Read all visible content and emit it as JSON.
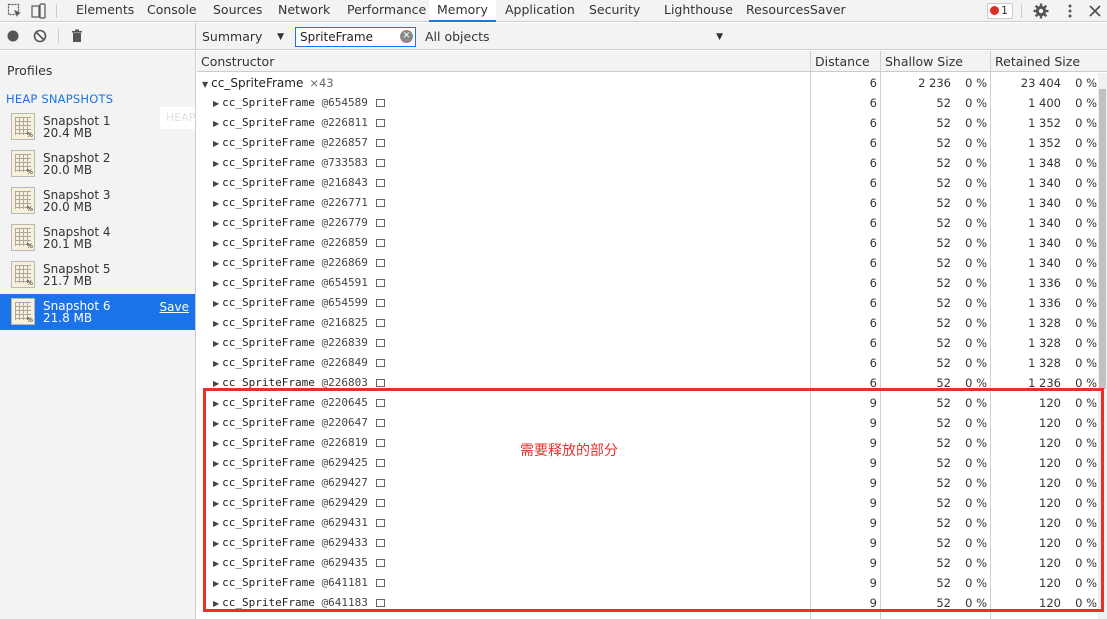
{
  "tabs": {
    "items": [
      "Elements",
      "Console",
      "Sources",
      "Network",
      "Performance",
      "Memory",
      "Application",
      "Security",
      "Lighthouse",
      "ResourcesSaver"
    ],
    "active": "Memory",
    "error_count": "1"
  },
  "toolbar": {
    "view": "Summary",
    "filter_value": "SpriteFrame",
    "objects": "All objects"
  },
  "sidebar": {
    "title": "Profiles",
    "section": "HEAP SNAPSHOTS",
    "ghost_text": "HEAP S",
    "snapshots": [
      {
        "name": "Snapshot 1",
        "size": "20.4 MB"
      },
      {
        "name": "Snapshot 2",
        "size": "20.0 MB"
      },
      {
        "name": "Snapshot 3",
        "size": "20.0 MB"
      },
      {
        "name": "Snapshot 4",
        "size": "20.1 MB"
      },
      {
        "name": "Snapshot 5",
        "size": "21.7 MB"
      },
      {
        "name": "Snapshot 6",
        "size": "21.8 MB"
      }
    ],
    "selected_index": 5,
    "save_label": "Save"
  },
  "table": {
    "headers": {
      "constructor": "Constructor",
      "distance": "Distance",
      "shallow": "Shallow Size",
      "retained": "Retained Size"
    },
    "group": {
      "name": "cc_SpriteFrame",
      "count": "×43",
      "distance": "6",
      "shallow": "2 236",
      "shallow_pct": "0 %",
      "retained": "23 404",
      "retained_pct": "0 %"
    },
    "rows": [
      {
        "name": "cc_SpriteFrame",
        "id": "@654589",
        "distance": "6",
        "shallow": "52",
        "shallow_pct": "0 %",
        "retained": "1 400",
        "retained_pct": "0 %"
      },
      {
        "name": "cc_SpriteFrame",
        "id": "@226811",
        "distance": "6",
        "shallow": "52",
        "shallow_pct": "0 %",
        "retained": "1 352",
        "retained_pct": "0 %"
      },
      {
        "name": "cc_SpriteFrame",
        "id": "@226857",
        "distance": "6",
        "shallow": "52",
        "shallow_pct": "0 %",
        "retained": "1 352",
        "retained_pct": "0 %"
      },
      {
        "name": "cc_SpriteFrame",
        "id": "@733583",
        "distance": "6",
        "shallow": "52",
        "shallow_pct": "0 %",
        "retained": "1 348",
        "retained_pct": "0 %"
      },
      {
        "name": "cc_SpriteFrame",
        "id": "@216843",
        "distance": "6",
        "shallow": "52",
        "shallow_pct": "0 %",
        "retained": "1 340",
        "retained_pct": "0 %"
      },
      {
        "name": "cc_SpriteFrame",
        "id": "@226771",
        "distance": "6",
        "shallow": "52",
        "shallow_pct": "0 %",
        "retained": "1 340",
        "retained_pct": "0 %"
      },
      {
        "name": "cc_SpriteFrame",
        "id": "@226779",
        "distance": "6",
        "shallow": "52",
        "shallow_pct": "0 %",
        "retained": "1 340",
        "retained_pct": "0 %"
      },
      {
        "name": "cc_SpriteFrame",
        "id": "@226859",
        "distance": "6",
        "shallow": "52",
        "shallow_pct": "0 %",
        "retained": "1 340",
        "retained_pct": "0 %"
      },
      {
        "name": "cc_SpriteFrame",
        "id": "@226869",
        "distance": "6",
        "shallow": "52",
        "shallow_pct": "0 %",
        "retained": "1 340",
        "retained_pct": "0 %"
      },
      {
        "name": "cc_SpriteFrame",
        "id": "@654591",
        "distance": "6",
        "shallow": "52",
        "shallow_pct": "0 %",
        "retained": "1 336",
        "retained_pct": "0 %"
      },
      {
        "name": "cc_SpriteFrame",
        "id": "@654599",
        "distance": "6",
        "shallow": "52",
        "shallow_pct": "0 %",
        "retained": "1 336",
        "retained_pct": "0 %"
      },
      {
        "name": "cc_SpriteFrame",
        "id": "@216825",
        "distance": "6",
        "shallow": "52",
        "shallow_pct": "0 %",
        "retained": "1 328",
        "retained_pct": "0 %"
      },
      {
        "name": "cc_SpriteFrame",
        "id": "@226839",
        "distance": "6",
        "shallow": "52",
        "shallow_pct": "0 %",
        "retained": "1 328",
        "retained_pct": "0 %"
      },
      {
        "name": "cc_SpriteFrame",
        "id": "@226849",
        "distance": "6",
        "shallow": "52",
        "shallow_pct": "0 %",
        "retained": "1 328",
        "retained_pct": "0 %"
      },
      {
        "name": "cc_SpriteFrame",
        "id": "@226803",
        "distance": "6",
        "shallow": "52",
        "shallow_pct": "0 %",
        "retained": "1 236",
        "retained_pct": "0 %"
      },
      {
        "name": "cc_SpriteFrame",
        "id": "@220645",
        "distance": "9",
        "shallow": "52",
        "shallow_pct": "0 %",
        "retained": "120",
        "retained_pct": "0 %"
      },
      {
        "name": "cc_SpriteFrame",
        "id": "@220647",
        "distance": "9",
        "shallow": "52",
        "shallow_pct": "0 %",
        "retained": "120",
        "retained_pct": "0 %"
      },
      {
        "name": "cc_SpriteFrame",
        "id": "@226819",
        "distance": "9",
        "shallow": "52",
        "shallow_pct": "0 %",
        "retained": "120",
        "retained_pct": "0 %"
      },
      {
        "name": "cc_SpriteFrame",
        "id": "@629425",
        "distance": "9",
        "shallow": "52",
        "shallow_pct": "0 %",
        "retained": "120",
        "retained_pct": "0 %"
      },
      {
        "name": "cc_SpriteFrame",
        "id": "@629427",
        "distance": "9",
        "shallow": "52",
        "shallow_pct": "0 %",
        "retained": "120",
        "retained_pct": "0 %"
      },
      {
        "name": "cc_SpriteFrame",
        "id": "@629429",
        "distance": "9",
        "shallow": "52",
        "shallow_pct": "0 %",
        "retained": "120",
        "retained_pct": "0 %"
      },
      {
        "name": "cc_SpriteFrame",
        "id": "@629431",
        "distance": "9",
        "shallow": "52",
        "shallow_pct": "0 %",
        "retained": "120",
        "retained_pct": "0 %"
      },
      {
        "name": "cc_SpriteFrame",
        "id": "@629433",
        "distance": "9",
        "shallow": "52",
        "shallow_pct": "0 %",
        "retained": "120",
        "retained_pct": "0 %"
      },
      {
        "name": "cc_SpriteFrame",
        "id": "@629435",
        "distance": "9",
        "shallow": "52",
        "shallow_pct": "0 %",
        "retained": "120",
        "retained_pct": "0 %"
      },
      {
        "name": "cc_SpriteFrame",
        "id": "@641181",
        "distance": "9",
        "shallow": "52",
        "shallow_pct": "0 %",
        "retained": "120",
        "retained_pct": "0 %"
      },
      {
        "name": "cc_SpriteFrame",
        "id": "@641183",
        "distance": "9",
        "shallow": "52",
        "shallow_pct": "0 %",
        "retained": "120",
        "retained_pct": "0 %"
      }
    ]
  },
  "annotation": {
    "text": "需要释放的部分",
    "color": "#e8302b"
  },
  "colors": {
    "accent": "#1a73e8",
    "error": "#d93025"
  }
}
